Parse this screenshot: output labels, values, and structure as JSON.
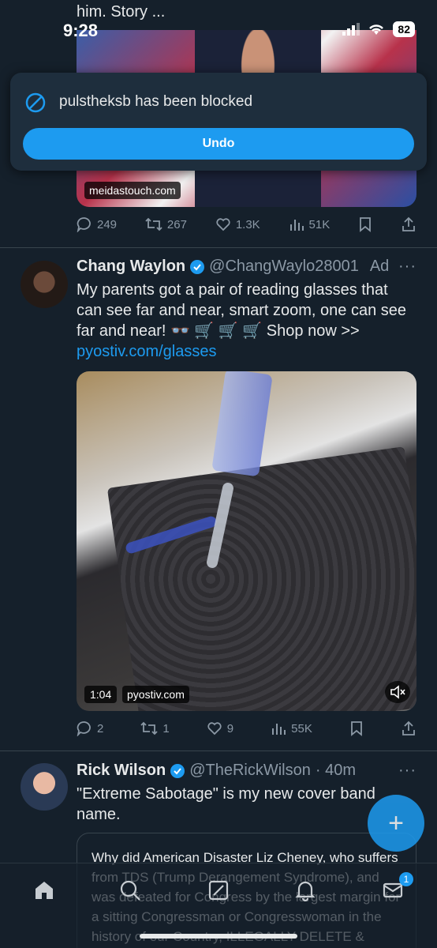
{
  "status_bar": {
    "time": "9:28",
    "battery": "82"
  },
  "previous_tweet": {
    "truncated_text": "him. Story ...",
    "media_source": "meidastouch.com",
    "stats": {
      "replies": "249",
      "retweets": "267",
      "likes": "1.3K",
      "views": "51K"
    }
  },
  "toast": {
    "message": "pulstheksb has been blocked",
    "undo_label": "Undo"
  },
  "ad_tweet": {
    "name": "Chang Waylon",
    "handle": "@ChangWaylo28001",
    "ad_label": "Ad",
    "text": "My parents got a pair of reading glasses that can see far and near, smart zoom, one can see far and near! 👓 🛒 🛒 🛒 Shop now >>",
    "link": "pyostiv.com/glasses",
    "video": {
      "duration": "1:04",
      "source": "pyostiv.com"
    },
    "stats": {
      "replies": "2",
      "retweets": "1",
      "likes": "9",
      "views": "55K"
    }
  },
  "next_tweet": {
    "name": "Rick Wilson",
    "handle": "@TheRickWilson",
    "time": "· 40m",
    "text": "\"Extreme Sabotage\" is my new cover band name.",
    "quote_text": "Why did American Disaster Liz Cheney, who suffers from TDS (Trump Derangement Syndrome), and was defeated for Congress by the largest margin for a sitting Congressman or Congresswoman in the history of our Country, ILLEGALLY DELETE & DESTROY most of the"
  },
  "bottom_nav": {
    "messages_badge": "1"
  },
  "colors": {
    "background": "#15202b",
    "accent": "#1d9bf0",
    "muted": "#8b98a5",
    "text": "#e7e9ea"
  }
}
